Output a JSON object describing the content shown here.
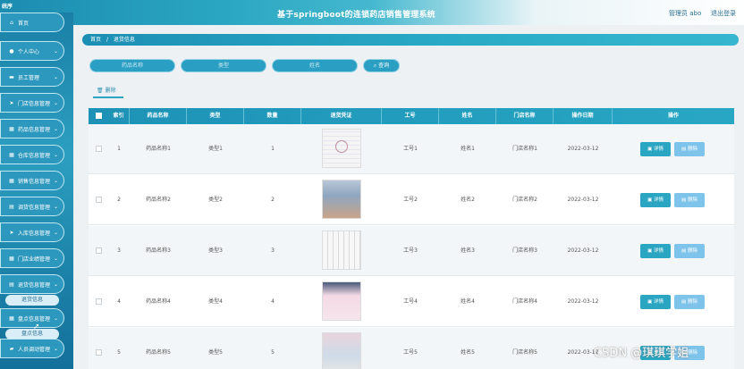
{
  "app": {
    "brand": "统序",
    "title": "基于springboot的连锁药店销售管理系统",
    "user": "管理员 abo",
    "logout": "退出登录"
  },
  "sidebar": {
    "items": [
      {
        "label": "首页",
        "icon": "home-icon"
      },
      {
        "label": "个人中心",
        "icon": "user-icon"
      },
      {
        "label": "员工管理",
        "icon": "monitor-icon"
      },
      {
        "label": "门店信息管理",
        "icon": "send-icon"
      },
      {
        "label": "药品信息管理",
        "icon": "grid-icon"
      },
      {
        "label": "仓库信息管理",
        "icon": "grid-icon"
      },
      {
        "label": "销售信息管理",
        "icon": "grid-icon"
      },
      {
        "label": "调货信息管理",
        "icon": "doc-icon"
      },
      {
        "label": "入库信息管理",
        "icon": "send-icon"
      },
      {
        "label": "门店业绩管理",
        "icon": "grid-icon"
      },
      {
        "label": "退货信息管理",
        "icon": "doc-icon"
      },
      {
        "label": "盘点信息管理",
        "icon": "grid-icon"
      },
      {
        "label": "人员调动管理",
        "icon": "folder-icon"
      }
    ],
    "sub_items": [
      "退货信息",
      "盘点信息"
    ]
  },
  "breadcrumb": {
    "home": "首页",
    "sep": "/",
    "current": "退货信息"
  },
  "search": {
    "field1": "药品名称",
    "field2": "类型",
    "field3": "姓名",
    "button": "查询"
  },
  "actions": {
    "delete_tab": "删除"
  },
  "table": {
    "headers": [
      "索引",
      "药品名称",
      "类型",
      "数量",
      "退货凭证",
      "工号",
      "姓名",
      "门店名称",
      "操作日期",
      "操作"
    ],
    "detail_label": "详情",
    "delete_label": "删除",
    "rows": [
      {
        "index": "1",
        "name": "药品名称1",
        "type": "类型1",
        "qty": "1",
        "empno": "工号1",
        "person": "姓名1",
        "store": "门店名称1",
        "date": "2022-03-12"
      },
      {
        "index": "2",
        "name": "药品名称2",
        "type": "类型2",
        "qty": "2",
        "empno": "工号2",
        "person": "姓名2",
        "store": "门店名称2",
        "date": "2022-03-12"
      },
      {
        "index": "3",
        "name": "药品名称3",
        "type": "类型3",
        "qty": "3",
        "empno": "工号3",
        "person": "姓名3",
        "store": "门店名称3",
        "date": "2022-03-12"
      },
      {
        "index": "4",
        "name": "药品名称4",
        "type": "类型4",
        "qty": "4",
        "empno": "工号4",
        "person": "姓名4",
        "store": "门店名称4",
        "date": "2022-03-12"
      },
      {
        "index": "5",
        "name": "药品名称5",
        "type": "类型5",
        "qty": "5",
        "empno": "工号5",
        "person": "姓名5",
        "store": "门店名称5",
        "date": "2022-03-12"
      }
    ]
  },
  "watermark": "CSDN @琪琪学姐",
  "colors": {
    "accent": "#2aa6c2",
    "accent_dark": "#1c8cb0",
    "delete_btn": "#7ec3ea"
  }
}
